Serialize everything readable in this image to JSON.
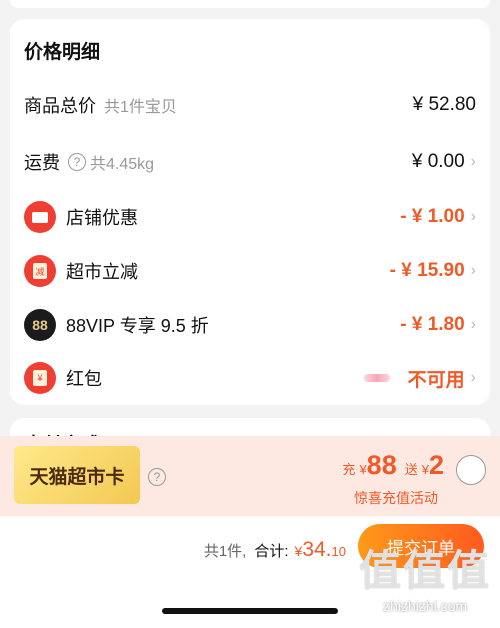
{
  "price_details": {
    "title": "价格明细",
    "rows": [
      {
        "label": "商品总价",
        "sub": "共1件宝贝",
        "amount": "¥ 52.80"
      },
      {
        "label": "运费",
        "sub": "共4.45kg",
        "amount": "¥ 0.00"
      },
      {
        "label": "店铺优惠",
        "amount": "- ¥ 1.00",
        "icon": "ticket-icon"
      },
      {
        "label": "超市立减",
        "amount": "- ¥ 15.90",
        "icon": "supermarket-discount-icon",
        "icon_text": "减"
      },
      {
        "label": "88VIP 专享 9.5 折",
        "amount": "- ¥ 1.80",
        "icon": "88vip-icon",
        "icon_text": "88"
      },
      {
        "label": "红包",
        "amount": "不可用",
        "icon": "red-packet-icon",
        "icon_text": "¥"
      }
    ]
  },
  "next_section": {
    "title": "支付方式"
  },
  "promo": {
    "card_name": "天猫超市卡",
    "recharge_label": "充",
    "recharge_currency": "¥",
    "recharge_amount": "88",
    "bonus_label": "送",
    "bonus_currency": "¥",
    "bonus_amount": "2",
    "subtitle": "惊喜充值活动"
  },
  "footer": {
    "count": "共1件,",
    "total_label": "合计:",
    "currency": "¥",
    "total_int": "34.",
    "total_dec": "10",
    "submit_label": "提交订单"
  },
  "watermark": {
    "logo": "值",
    "url": "zhizhizhi.com"
  },
  "colors": {
    "accent": "#f05a28",
    "icon_red": "#ef3f33",
    "background": "#f3f3f3"
  }
}
